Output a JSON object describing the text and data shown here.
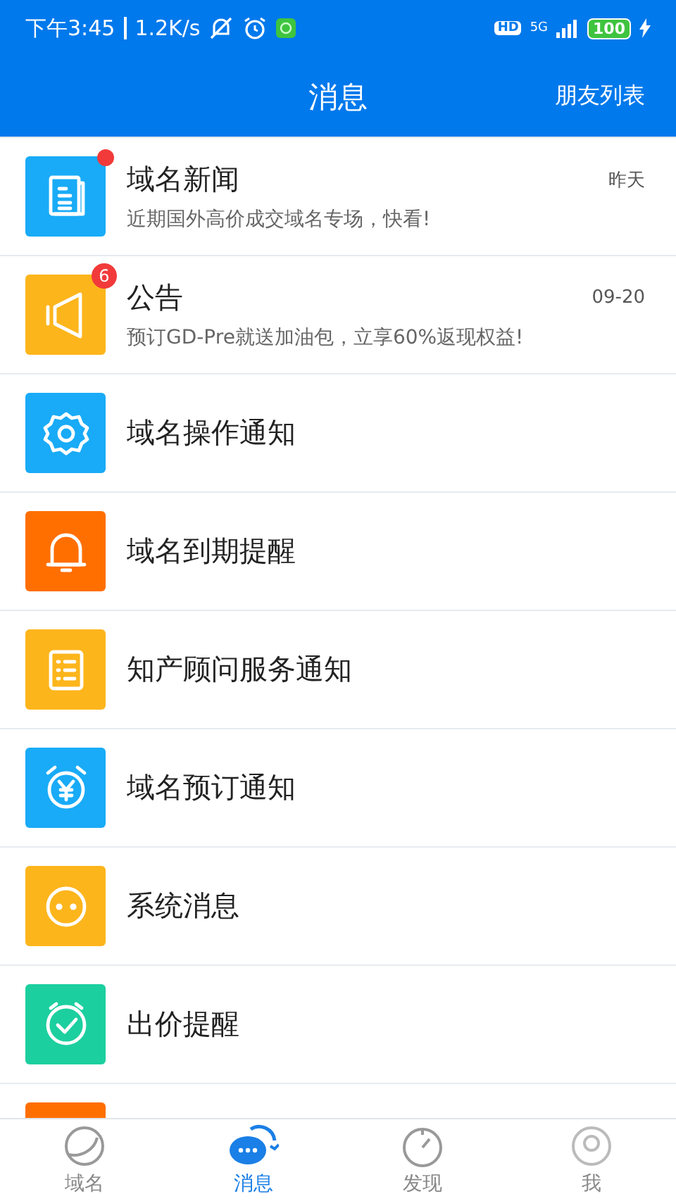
{
  "status_bar": {
    "time": "下午3:45",
    "speed": "1.2K/s",
    "hd": "HD",
    "network": "5G",
    "battery": "100"
  },
  "header": {
    "title": "消息",
    "action": "朋友列表"
  },
  "messages": [
    {
      "title": "域名新闻",
      "preview": "近期国外高价成交域名专场，快看!",
      "time": "昨天",
      "color": "#19abf7",
      "unread_dot": true
    },
    {
      "title": "公告",
      "preview": "预订GD-Pre就送加油包，立享60%返现权益!",
      "time": "09-20",
      "color": "#fdb51c",
      "badge": "6"
    },
    {
      "title": "域名操作通知",
      "color": "#19abf7"
    },
    {
      "title": "域名到期提醒",
      "color": "#ff6f00"
    },
    {
      "title": "知产顾问服务通知",
      "color": "#fdb51c"
    },
    {
      "title": "域名预订通知",
      "color": "#19abf7"
    },
    {
      "title": "系统消息",
      "color": "#fdb51c"
    },
    {
      "title": "出价提醒",
      "color": "#1ccf9f"
    },
    {
      "color": "#ff6f00"
    }
  ],
  "tabs": [
    {
      "label": "域名",
      "selected": false
    },
    {
      "label": "消息",
      "selected": true
    },
    {
      "label": "发现",
      "selected": false
    },
    {
      "label": "我",
      "selected": false
    }
  ]
}
